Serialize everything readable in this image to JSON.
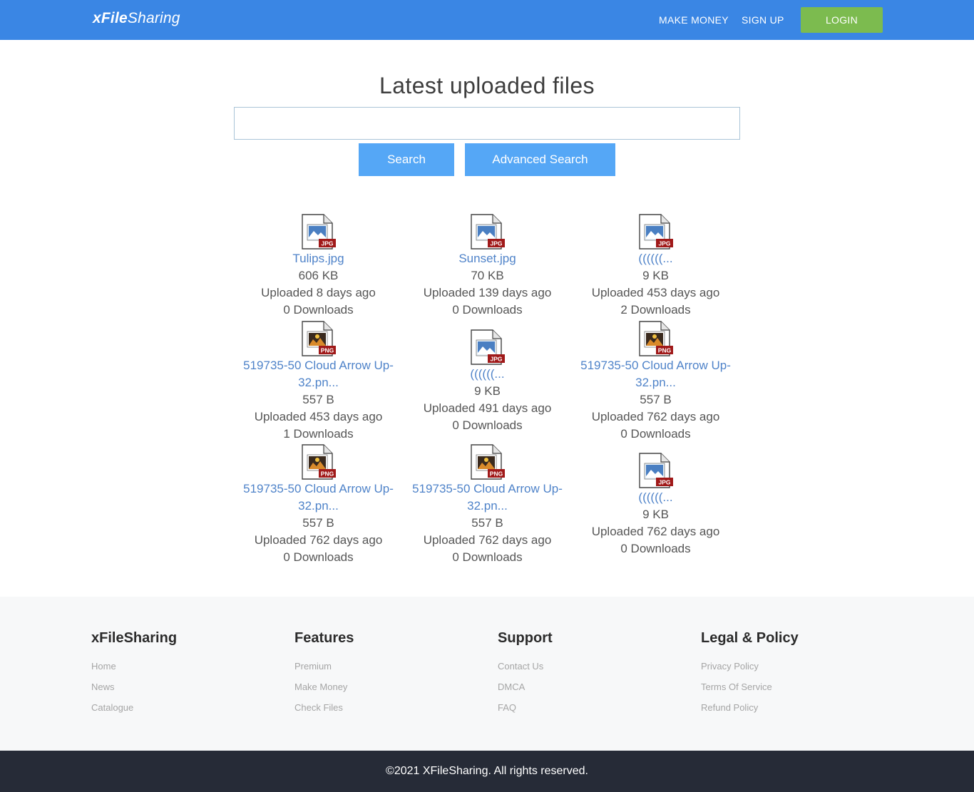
{
  "header": {
    "logo_bold": "xFile",
    "logo_light": "Sharing",
    "nav_make_money": "MAKE MONEY",
    "nav_sign_up": "SIGN UP",
    "login": "LOGIN"
  },
  "hero": {
    "title": "Latest uploaded files",
    "search_value": "",
    "search_button": "Search",
    "advanced_button": "Advanced Search"
  },
  "files": [
    {
      "type": "JPG",
      "name": "Tulips.jpg",
      "size": "606 KB",
      "uploaded": "Uploaded 8 days ago",
      "downloads": "0 Downloads"
    },
    {
      "type": "JPG",
      "name": "Sunset.jpg",
      "size": "70 KB",
      "uploaded": "Uploaded 139 days ago",
      "downloads": "0 Downloads"
    },
    {
      "type": "JPG",
      "name": "((((((...",
      "size": "9 KB",
      "uploaded": "Uploaded 453 days ago",
      "downloads": "2 Downloads"
    },
    {
      "type": "PNG",
      "name": "519735-50 Cloud Arrow Up-32.pn...",
      "size": "557 B",
      "uploaded": "Uploaded 453 days ago",
      "downloads": "1 Downloads"
    },
    {
      "type": "JPG",
      "name": "((((((...",
      "size": "9 KB",
      "uploaded": "Uploaded 491 days ago",
      "downloads": "0 Downloads"
    },
    {
      "type": "PNG",
      "name": "519735-50 Cloud Arrow Up-32.pn...",
      "size": "557 B",
      "uploaded": "Uploaded 762 days ago",
      "downloads": "0 Downloads"
    },
    {
      "type": "PNG",
      "name": "519735-50 Cloud Arrow Up-32.pn...",
      "size": "557 B",
      "uploaded": "Uploaded 762 days ago",
      "downloads": "0 Downloads"
    },
    {
      "type": "PNG",
      "name": "519735-50 Cloud Arrow Up-32.pn...",
      "size": "557 B",
      "uploaded": "Uploaded 762 days ago",
      "downloads": "0 Downloads"
    },
    {
      "type": "JPG",
      "name": "((((((...",
      "size": "9 KB",
      "uploaded": "Uploaded 762 days ago",
      "downloads": "0 Downloads"
    }
  ],
  "footer": {
    "col1": {
      "title": "xFileSharing",
      "links": [
        "Home",
        "News",
        "Catalogue"
      ]
    },
    "col2": {
      "title": "Features",
      "links": [
        "Premium",
        "Make Money",
        "Check Files"
      ]
    },
    "col3": {
      "title": "Support",
      "links": [
        "Contact Us",
        "DMCA",
        "FAQ"
      ]
    },
    "col4": {
      "title": "Legal & Policy",
      "links": [
        "Privacy Policy",
        "Terms Of Service",
        "Refund Policy"
      ]
    },
    "copyright": "©2021 XFileSharing. All rights reserved."
  },
  "colors": {
    "header": "#3a86e4",
    "login": "#7cbb4f",
    "button": "#55a7f6",
    "link": "#4f83c9",
    "bottom_bar": "#262b37"
  }
}
